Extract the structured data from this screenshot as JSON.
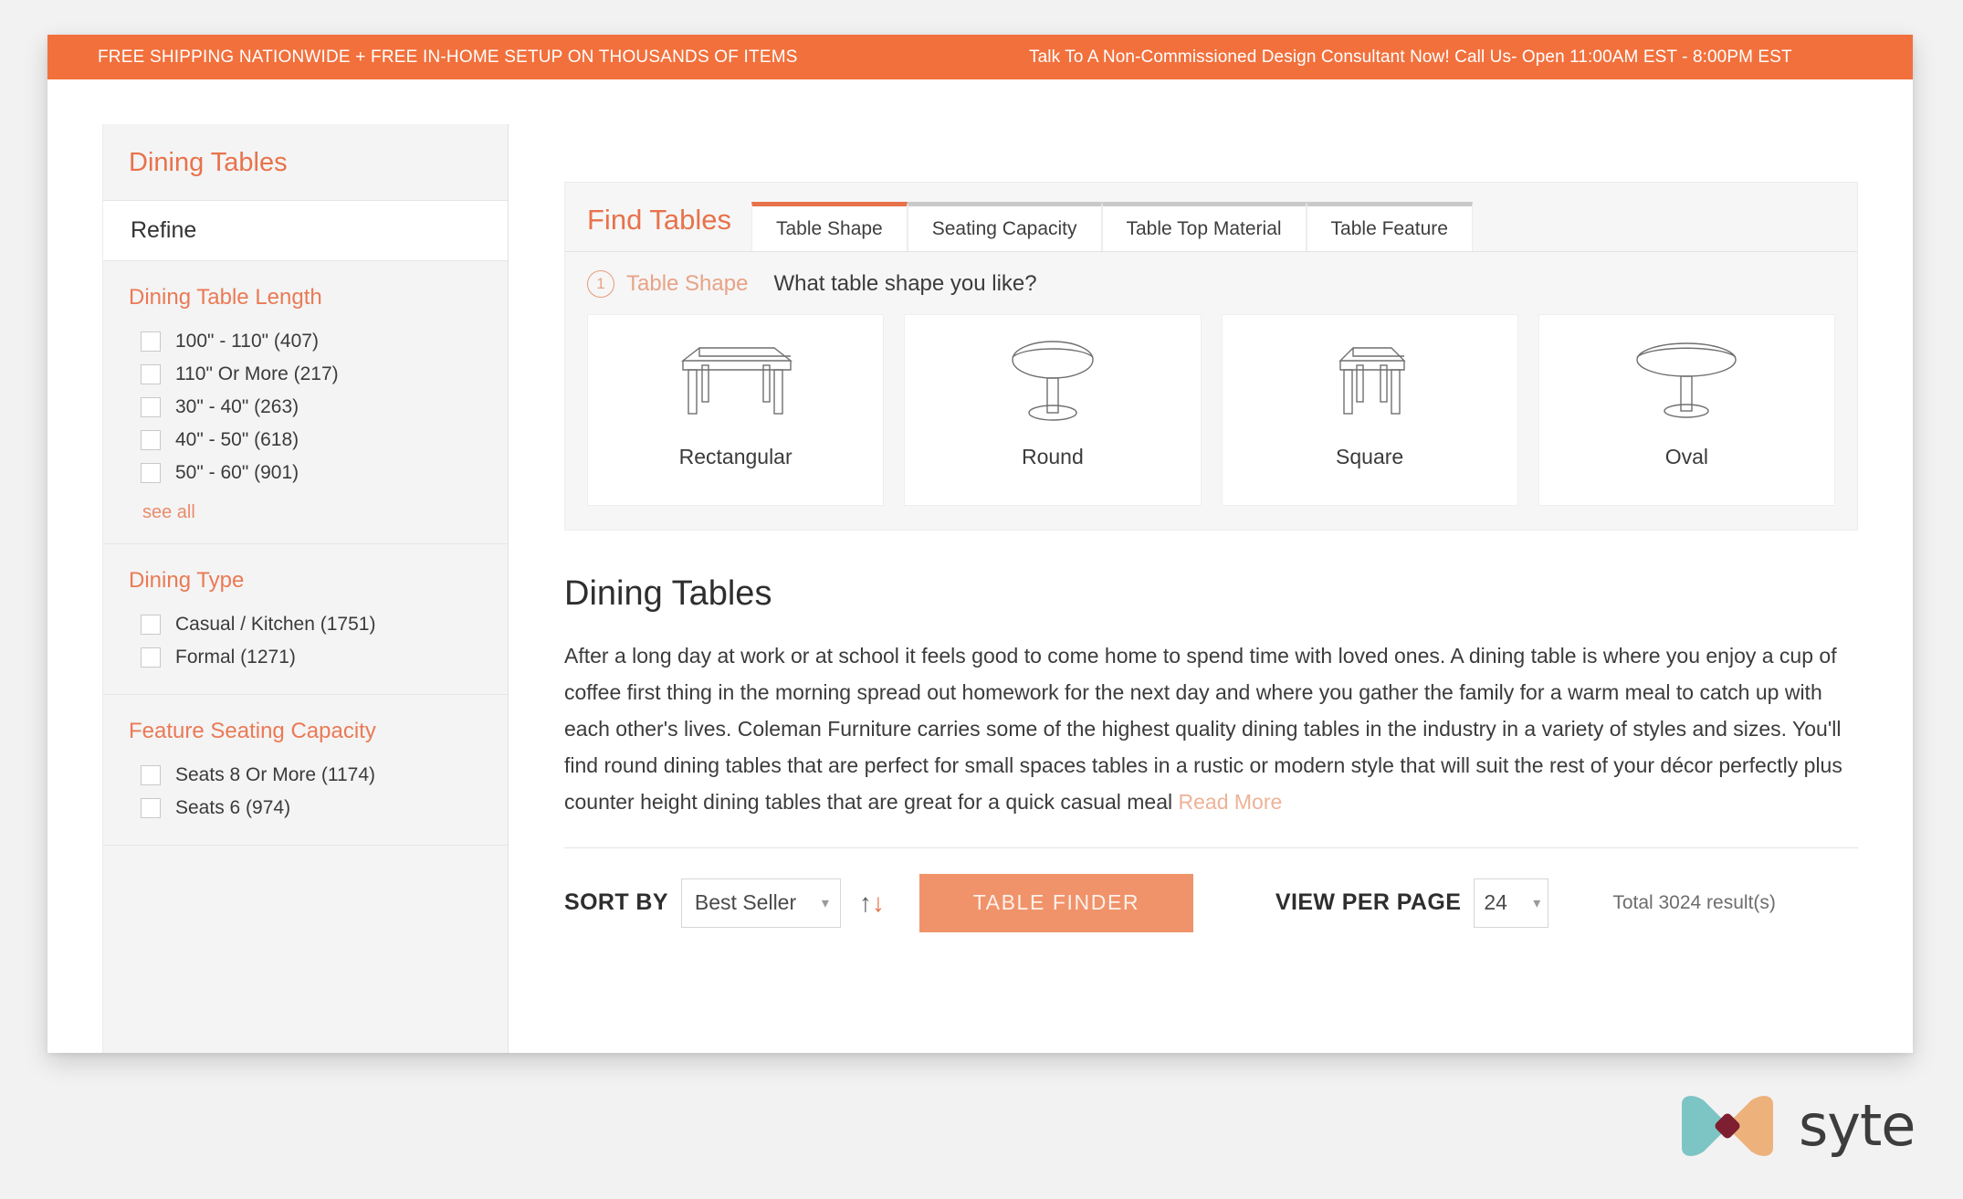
{
  "banner": {
    "left_text": "FREE SHIPPING NATIONWIDE + FREE IN-HOME SETUP ON THOUSANDS OF ITEMS",
    "right_text": "Talk To A Non-Commissioned Design Consultant Now! Call Us- Open 11:00AM EST - 8:00PM EST",
    "background_color": "#f2703c"
  },
  "sidebar": {
    "title": "Dining Tables",
    "refine_label": "Refine",
    "see_all_label": "see all",
    "groups": [
      {
        "title": "Dining Table Length",
        "options": [
          {
            "label": "100\" - 110\" (407)"
          },
          {
            "label": "110\" Or More (217)"
          },
          {
            "label": "30\" - 40\" (263)"
          },
          {
            "label": "40\" - 50\" (618)"
          },
          {
            "label": "50\" - 60\" (901)"
          }
        ],
        "has_see_all": true
      },
      {
        "title": "Dining Type",
        "options": [
          {
            "label": "Casual / Kitchen (1751)"
          },
          {
            "label": "Formal (1271)"
          }
        ],
        "has_see_all": false
      },
      {
        "title": "Feature Seating Capacity",
        "options": [
          {
            "label": "Seats 8 Or More (1174)"
          },
          {
            "label": "Seats 6 (974)"
          }
        ],
        "has_see_all": false
      }
    ]
  },
  "finder": {
    "title": "Find Tables",
    "tabs": [
      {
        "label": "Table Shape",
        "active": true
      },
      {
        "label": "Seating Capacity",
        "active": false
      },
      {
        "label": "Table Top Material",
        "active": false
      },
      {
        "label": "Table Feature",
        "active": false
      }
    ],
    "step_number": "1",
    "step_key": "Table Shape",
    "question": "What table shape you like?",
    "shapes": [
      {
        "label": "Rectangular",
        "icon": "rectangular-table-icon"
      },
      {
        "label": "Round",
        "icon": "round-table-icon"
      },
      {
        "label": "Square",
        "icon": "square-table-icon"
      },
      {
        "label": "Oval",
        "icon": "oval-table-icon"
      }
    ],
    "accent_color": "#e8724b"
  },
  "description": {
    "heading": "Dining Tables",
    "body": "After a long day at work or at school it feels good to come home to spend time with loved ones. A dining table is where you enjoy a cup of coffee first thing in the morning spread out homework for the next day and where you gather the family for a warm meal to catch up with each other's lives. Coleman Furniture carries some of the highest quality dining tables in the industry in a variety of styles and sizes. You'll find round dining tables that are perfect for small spaces tables in a rustic or modern style that will suit the rest of your décor perfectly plus counter height dining tables that are great for a quick casual meal ",
    "read_more": "Read More"
  },
  "toolbar": {
    "sort_by_label": "SORT BY",
    "sort_value": "Best Seller",
    "sort_direction_icon": "sort-arrows-icon",
    "table_finder_label": "TABLE FINDER",
    "view_per_page_label": "VIEW PER PAGE",
    "view_per_page_value": "24",
    "total_results": "Total 3024 result(s)"
  },
  "watermark": {
    "brand": "syte",
    "mark_left_color": "#7cc5c4",
    "mark_right_color": "#edb17c",
    "mark_center_color": "#7d1f30"
  }
}
